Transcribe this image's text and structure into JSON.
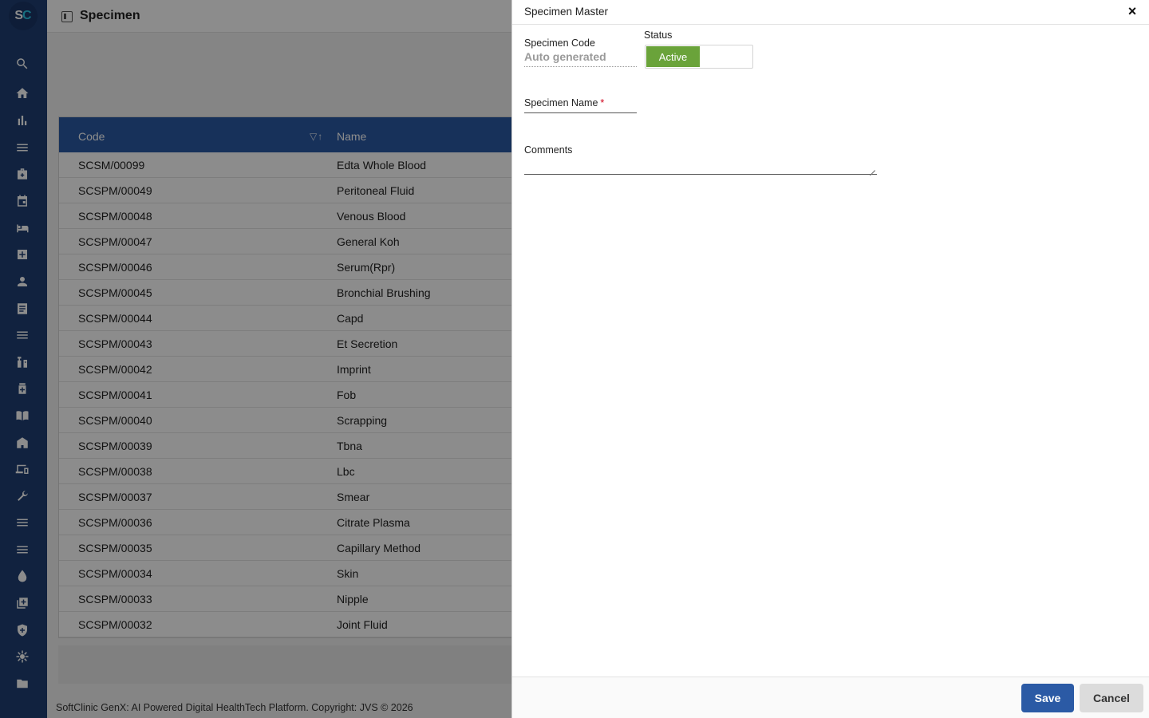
{
  "app": {
    "logo_text_1": "S",
    "logo_text_2": "C",
    "page_title": "Specimen"
  },
  "sidebar": {
    "icons": [
      "search-icon",
      "home-icon",
      "bar-chart-icon",
      "menu-icon",
      "medical-bag-icon",
      "calendar-icon",
      "bed-icon",
      "medical-plus-icon",
      "person-icon",
      "document-icon",
      "menu-icon",
      "injection-icon",
      "medicine-icon",
      "book-icon",
      "building-icon",
      "devices-icon",
      "wrench-icon",
      "menu-icon",
      "menu-icon",
      "drop-icon",
      "add-box-icon",
      "shield-icon",
      "network-icon",
      "folder-icon"
    ]
  },
  "grid": {
    "columns": {
      "code": "Code",
      "name": "Name",
      "filter_glyph": "▽↑"
    },
    "rows": [
      {
        "code": "SCSM/00099",
        "name": "Edta Whole Blood"
      },
      {
        "code": "SCSPM/00049",
        "name": "Peritoneal Fluid"
      },
      {
        "code": "SCSPM/00048",
        "name": "Venous Blood"
      },
      {
        "code": "SCSPM/00047",
        "name": "General Koh"
      },
      {
        "code": "SCSPM/00046",
        "name": "Serum(Rpr)"
      },
      {
        "code": "SCSPM/00045",
        "name": "Bronchial Brushing"
      },
      {
        "code": "SCSPM/00044",
        "name": "Capd"
      },
      {
        "code": "SCSPM/00043",
        "name": "Et Secretion"
      },
      {
        "code": "SCSPM/00042",
        "name": "Imprint"
      },
      {
        "code": "SCSPM/00041",
        "name": "Fob"
      },
      {
        "code": "SCSPM/00040",
        "name": "Scrapping"
      },
      {
        "code": "SCSPM/00039",
        "name": "Tbna"
      },
      {
        "code": "SCSPM/00038",
        "name": "Lbc"
      },
      {
        "code": "SCSPM/00037",
        "name": "Smear"
      },
      {
        "code": "SCSPM/00036",
        "name": "Citrate Plasma"
      },
      {
        "code": "SCSPM/00035",
        "name": "Capillary Method"
      },
      {
        "code": "SCSPM/00034",
        "name": "Skin"
      },
      {
        "code": "SCSPM/00033",
        "name": "Nipple"
      },
      {
        "code": "SCSPM/00032",
        "name": "Joint Fluid"
      }
    ]
  },
  "footer": {
    "text": "SoftClinic GenX: AI Powered Digital HealthTech Platform. Copyright: JVS © 2026"
  },
  "modal": {
    "title": "Specimen Master",
    "close_glyph": "×",
    "specimen_code_label": "Specimen Code",
    "specimen_code_value": "Auto generated",
    "status_label": "Status",
    "status_value": "Active",
    "specimen_name_label": "Specimen Name",
    "required_marker": "*",
    "specimen_name_value": "",
    "comments_label": "Comments",
    "comments_value": "",
    "save_label": "Save",
    "cancel_label": "Cancel"
  },
  "colors": {
    "sidebar": "#1f3f73",
    "grid_header": "#2b5aa5",
    "active_status": "#6aa33a",
    "save_button": "#2b5aa5",
    "required": "#d0021b"
  }
}
